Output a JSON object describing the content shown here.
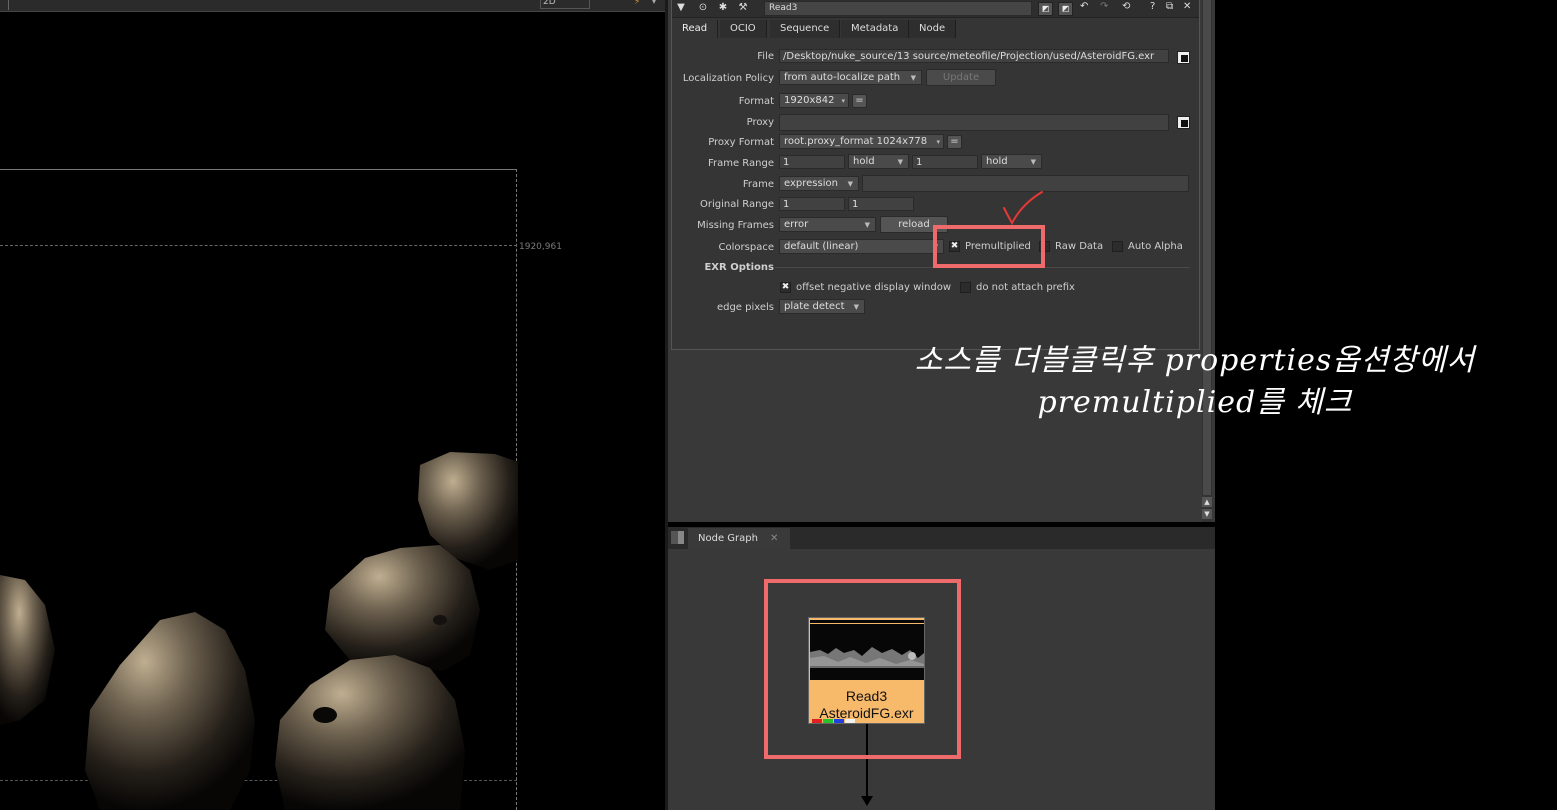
{
  "viewer": {
    "zoom_mode": "2D",
    "coord_readout": "1920,961"
  },
  "properties": {
    "node_name": "Read3",
    "tabs": [
      "Read",
      "OCIO",
      "Sequence",
      "Metadata",
      "Node"
    ],
    "active_tab": "Read",
    "file": {
      "label": "File",
      "value": "/Desktop/nuke_source/13 source/meteofile/Projection/used/AsteroidFG.exr"
    },
    "localization_policy": {
      "label": "Localization Policy",
      "value": "from auto-localize path",
      "update_label": "Update"
    },
    "format": {
      "label": "Format",
      "value": "1920x842"
    },
    "proxy": {
      "label": "Proxy",
      "value": ""
    },
    "proxy_format": {
      "label": "Proxy Format",
      "value": "root.proxy_format 1024x778"
    },
    "frame_range": {
      "label": "Frame Range",
      "start": "1",
      "before": "hold",
      "end": "1",
      "after": "hold"
    },
    "frame": {
      "label": "Frame",
      "mode": "expression",
      "value": ""
    },
    "original_range": {
      "label": "Original Range",
      "start": "1",
      "end": "1"
    },
    "missing_frames": {
      "label": "Missing Frames",
      "value": "error",
      "reload_label": "reload"
    },
    "colorspace": {
      "label": "Colorspace",
      "value": "default (linear)"
    },
    "premultiplied": {
      "label": "Premultiplied",
      "checked": true
    },
    "raw_data": {
      "label": "Raw Data",
      "checked": false
    },
    "auto_alpha": {
      "label": "Auto Alpha",
      "checked": false
    },
    "exr_options_label": "EXR Options",
    "offset_negative": {
      "label": "offset negative display window",
      "checked": true
    },
    "no_prefix": {
      "label": "do not attach prefix",
      "checked": false
    },
    "edge_pixels": {
      "label": "edge pixels",
      "value": "plate detect"
    }
  },
  "node_graph": {
    "tab_label": "Node Graph",
    "node": {
      "name": "Read3",
      "file": "AsteroidFG.exr"
    }
  },
  "annotation": {
    "line1": "소스를 더블클릭후 properties옵션창에서",
    "line2": "premultiplied를 체크"
  },
  "colors": {
    "highlight": "#ef6b6b",
    "read_node": "#f7b96a",
    "panel_bg": "#353535"
  },
  "icons": {
    "check": "✖",
    "dropdown": "▾"
  }
}
